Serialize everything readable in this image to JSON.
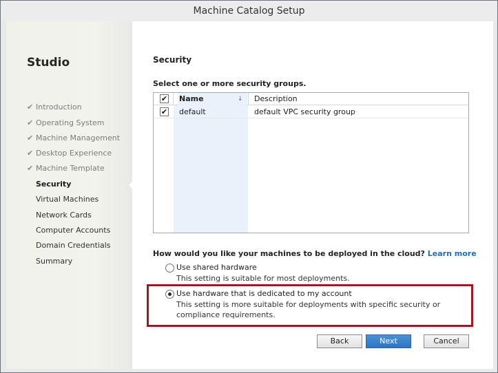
{
  "window": {
    "title": "Machine Catalog Setup"
  },
  "sidebar": {
    "brand": "Studio",
    "completed_mark": "✔",
    "items": [
      {
        "label": "Introduction",
        "state": "done"
      },
      {
        "label": "Operating System",
        "state": "done"
      },
      {
        "label": "Machine Management",
        "state": "done"
      },
      {
        "label": "Desktop Experience",
        "state": "done"
      },
      {
        "label": "Machine Template",
        "state": "done"
      },
      {
        "label": "Security",
        "state": "current"
      },
      {
        "label": "Virtual Machines",
        "state": "todo"
      },
      {
        "label": "Network Cards",
        "state": "todo"
      },
      {
        "label": "Computer Accounts",
        "state": "todo"
      },
      {
        "label": "Domain Credentials",
        "state": "todo"
      },
      {
        "label": "Summary",
        "state": "todo"
      }
    ]
  },
  "main": {
    "heading": "Security",
    "prompt": "Select one or more security groups.",
    "table": {
      "columns": {
        "name": "Name",
        "description": "Description"
      },
      "sort_indicator": "↓",
      "header_checked": true,
      "rows": [
        {
          "checked": true,
          "name": "default",
          "description": "default VPC security group"
        }
      ]
    },
    "question": "How would you like your machines to be deployed in the cloud?",
    "learn_more": "Learn more",
    "options": [
      {
        "label": "Use shared hardware",
        "description": "This setting is suitable for most deployments.",
        "selected": false
      },
      {
        "label": "Use hardware that is dedicated to my account",
        "description": "This setting is more suitable for deployments with specific security or compliance requirements.",
        "selected": true
      }
    ]
  },
  "buttons": {
    "back": "Back",
    "next": "Next",
    "cancel": "Cancel"
  },
  "colors": {
    "accent": "#2c75c4",
    "highlight_border": "#a3161a",
    "link": "#1f6fb8"
  }
}
